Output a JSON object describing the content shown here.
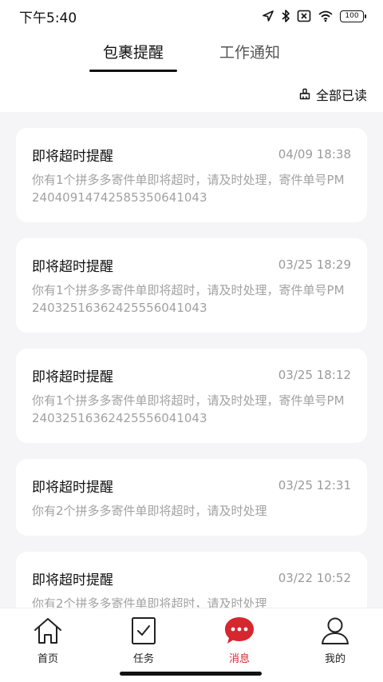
{
  "status_bar": {
    "time": "下午5:40",
    "battery": "100",
    "icons": [
      "location-arrow-icon",
      "bluetooth-icon",
      "no-sim-icon",
      "wifi-icon",
      "battery-icon"
    ]
  },
  "tabs": [
    {
      "label": "包裹提醒",
      "active": true
    },
    {
      "label": "工作通知",
      "active": false
    }
  ],
  "mark_all_read": {
    "label": "全部已读",
    "icon": "broom-icon"
  },
  "messages": [
    {
      "title": "即将超时提醒",
      "time": "04/09 18:38",
      "body": "你有1个拼多多寄件单即将超时，请及时处理，寄件单号PM2404091474258535064104​3"
    },
    {
      "title": "即将超时提醒",
      "time": "03/25 18:29",
      "body": "你有1个拼多多寄件单即将超时，请及时处理，寄件单号PM2403251636242555604104​3"
    },
    {
      "title": "即将超时提醒",
      "time": "03/25 18:12",
      "body": "你有1个拼多多寄件单即将超时，请及时处理，寄件单号PM2403251636242555604104​3"
    },
    {
      "title": "即将超时提醒",
      "time": "03/25 12:31",
      "body": "你有2个拼多多寄件单即将超时，请及时处理"
    },
    {
      "title": "即将超时提醒",
      "time": "03/22 10:52",
      "body": "你有2个拼多多寄件单即将超时，请及时处理"
    }
  ],
  "bottom_nav": [
    {
      "label": "首页",
      "icon": "home-icon",
      "active": false
    },
    {
      "label": "任务",
      "icon": "task-check-icon",
      "active": false
    },
    {
      "label": "消息",
      "icon": "message-bubble-icon",
      "active": true
    },
    {
      "label": "我的",
      "icon": "user-icon",
      "active": false
    }
  ],
  "colors": {
    "accent": "#d6262e",
    "background": "#f5f5f8",
    "card": "#ffffff",
    "muted_text": "#a2a2a2"
  }
}
